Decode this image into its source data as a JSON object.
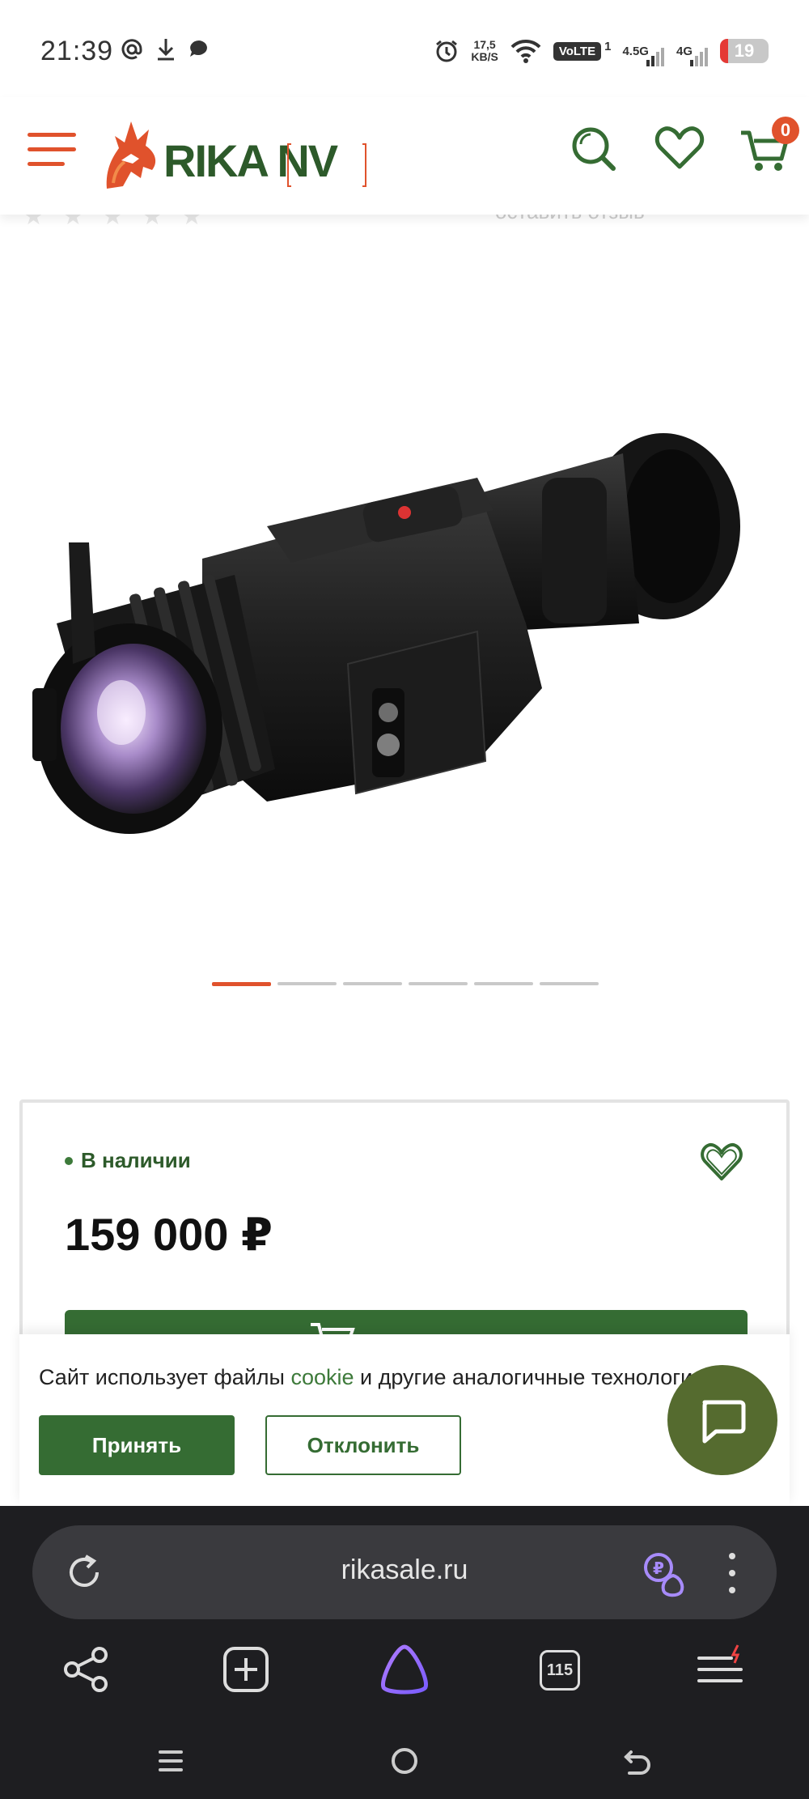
{
  "status_bar": {
    "time": "21:39",
    "net_speed_value": "17,5",
    "net_speed_unit": "KB/S",
    "volte": "VoLTE",
    "sim_index": "1",
    "signal_1": "4.5G",
    "signal_2": "4G",
    "battery": "19"
  },
  "header": {
    "logo_text": "RIKA NV",
    "cart_count": "0"
  },
  "rating_ghost": {
    "review_text": "оставить отзыв"
  },
  "carousel": {
    "count": 6,
    "active_index": 0
  },
  "product": {
    "availability": "В наличии",
    "price": "159 000 ₽"
  },
  "cookie_banner": {
    "text_before": "Сайт использует файлы ",
    "text_link": "cookie",
    "text_after": " и другие аналогичные технологии",
    "accept_label": "Принять",
    "decline_label": "Отклонить"
  },
  "browser": {
    "url": "rikasale.ru",
    "tabs_count": "115"
  },
  "colors": {
    "brand_green": "#356c33",
    "brand_orange": "#e0522c",
    "chat_olive": "#556b2f",
    "browser_bg": "#1e1e21"
  }
}
